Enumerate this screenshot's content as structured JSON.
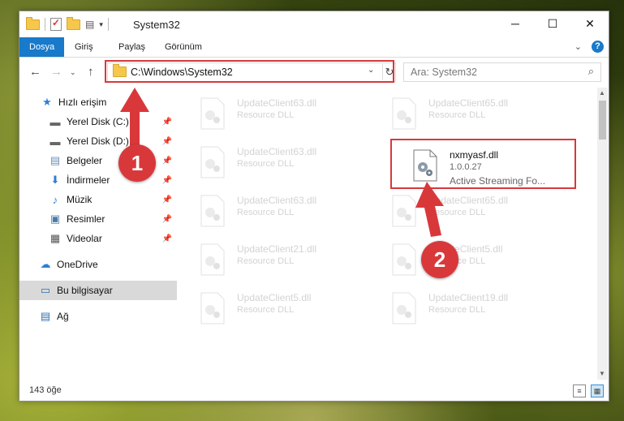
{
  "window": {
    "title": "System32"
  },
  "ribbon": {
    "tabs": [
      "Dosya",
      "Giriş",
      "Paylaş",
      "Görünüm"
    ]
  },
  "nav": {
    "address": "C:\\Windows\\System32",
    "search_placeholder": "Ara: System32"
  },
  "sidebar": {
    "items": [
      {
        "label": "Hızlı erişim",
        "icon": "star-icon"
      },
      {
        "label": "Yerel Disk (C:)",
        "icon": "drive-icon"
      },
      {
        "label": "Yerel Disk (D:)",
        "icon": "drive-icon"
      },
      {
        "label": "Belgeler",
        "icon": "documents-icon"
      },
      {
        "label": "İndirmeler",
        "icon": "download-icon"
      },
      {
        "label": "Müzik",
        "icon": "music-icon"
      },
      {
        "label": "Resimler",
        "icon": "pictures-icon"
      },
      {
        "label": "Videolar",
        "icon": "videos-icon"
      },
      {
        "label": "OneDrive",
        "icon": "cloud-icon"
      },
      {
        "label": "Bu bilgisayar",
        "icon": "computer-icon"
      },
      {
        "label": "Ağ",
        "icon": "network-icon"
      }
    ]
  },
  "files": [
    {
      "name": "UpdateClient63.dll",
      "sub": "Resource DLL"
    },
    {
      "name": "UpdateClient65.dll",
      "sub": "Resource DLL"
    },
    {
      "name": "UpdateClient63.dll",
      "sub": "Resource DLL"
    },
    {
      "name": "nxmyasf.dll",
      "sub": "1.0.0.27",
      "sub2": "Active Streaming Fo..."
    },
    {
      "name": "UpdateClient63.dll",
      "sub": "Resource DLL"
    },
    {
      "name": "UpdateClient65.dll",
      "sub": "Resource DLL"
    },
    {
      "name": "UpdateClient21.dll",
      "sub": "Resource DLL"
    },
    {
      "name": "UpdateClient5.dll",
      "sub": "Resource DLL"
    },
    {
      "name": "UpdateClient5.dll",
      "sub": "Resource DLL"
    },
    {
      "name": "UpdateClient19.dll",
      "sub": "Resource DLL"
    }
  ],
  "status": {
    "count": "143 öğe"
  },
  "annotations": {
    "badge1": "1",
    "badge2": "2",
    "color": "#d9383b"
  },
  "colors": {
    "accent": "#1979ca",
    "folder": "#f5c84c"
  }
}
